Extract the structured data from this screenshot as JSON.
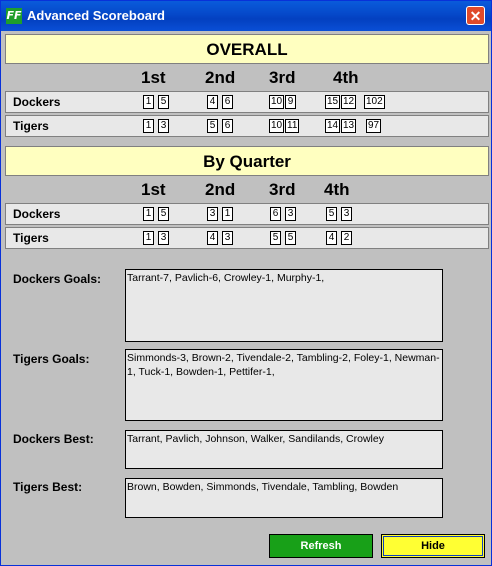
{
  "window": {
    "logo_text": "FF",
    "title": "Advanced Scoreboard",
    "close_glyph": "✕"
  },
  "overall": {
    "heading": "OVERALL",
    "quarters": [
      "1st",
      "2nd",
      "3rd",
      "4th"
    ],
    "teams": [
      {
        "name": "Dockers",
        "q1": [
          "1",
          "5"
        ],
        "q2": [
          "4",
          "6"
        ],
        "q3": [
          "10",
          "9"
        ],
        "q4": [
          "15",
          "12"
        ],
        "total": "102"
      },
      {
        "name": "Tigers",
        "q1": [
          "1",
          "3"
        ],
        "q2": [
          "5",
          "6"
        ],
        "q3": [
          "10",
          "11"
        ],
        "q4": [
          "14",
          "13"
        ],
        "total": "97"
      }
    ]
  },
  "by_quarter": {
    "heading": "By Quarter",
    "quarters": [
      "1st",
      "2nd",
      "3rd",
      "4th"
    ],
    "teams": [
      {
        "name": "Dockers",
        "q1": [
          "1",
          "5"
        ],
        "q2": [
          "3",
          "1"
        ],
        "q3": [
          "6",
          "3"
        ],
        "q4": [
          "5",
          "3"
        ]
      },
      {
        "name": "Tigers",
        "q1": [
          "1",
          "3"
        ],
        "q2": [
          "4",
          "3"
        ],
        "q3": [
          "5",
          "5"
        ],
        "q4": [
          "4",
          "2"
        ]
      }
    ]
  },
  "details": {
    "dockers_goals_label": "Dockers Goals:",
    "dockers_goals": "Tarrant-7, Pavlich-6, Crowley-1, Murphy-1,",
    "tigers_goals_label": "Tigers Goals:",
    "tigers_goals": "Simmonds-3, Brown-2, Tivendale-2, Tambling-2, Foley-1, Newman-1, Tuck-1, Bowden-1, Pettifer-1,",
    "dockers_best_label": "Dockers Best:",
    "dockers_best": "Tarrant, Pavlich, Johnson, Walker, Sandilands, Crowley",
    "tigers_best_label": "Tigers Best:",
    "tigers_best": "Brown, Bowden, Simmonds, Tivendale, Tambling, Bowden"
  },
  "buttons": {
    "refresh": "Refresh",
    "hide": "Hide"
  },
  "colors": {
    "heading_bg": "#ffffc0",
    "refresh_bg": "#18a018",
    "hide_bg": "#ffff33",
    "title_bar": "#0548c9"
  }
}
